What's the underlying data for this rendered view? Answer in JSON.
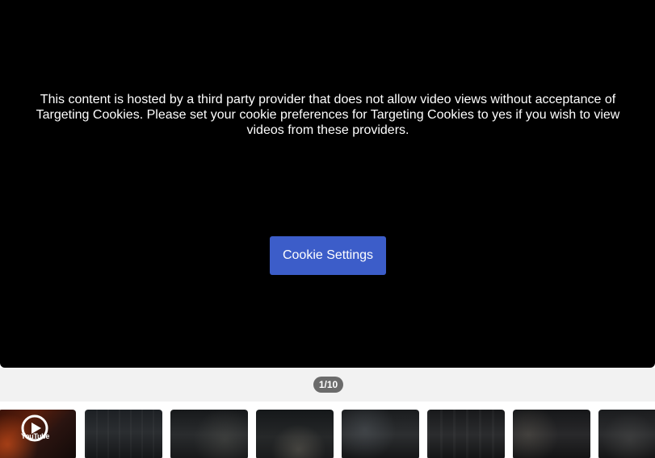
{
  "player": {
    "notice": "This content is hosted by a third party provider that does not allow video views without acceptance of Targeting Cookies. Please set your cookie preferences for Targeting Cookies to yes if you wish to view videos from these providers.",
    "cookie_button_label": "Cookie Settings",
    "accent_color": "#3c5dc9"
  },
  "gallery": {
    "counter": "1/10",
    "thumbnails": [
      {
        "kind": "video",
        "icon": "youtube-play-icon",
        "label": "YouTube"
      },
      {
        "kind": "image"
      },
      {
        "kind": "image"
      },
      {
        "kind": "image"
      },
      {
        "kind": "image"
      },
      {
        "kind": "image"
      },
      {
        "kind": "image"
      },
      {
        "kind": "image"
      }
    ]
  }
}
